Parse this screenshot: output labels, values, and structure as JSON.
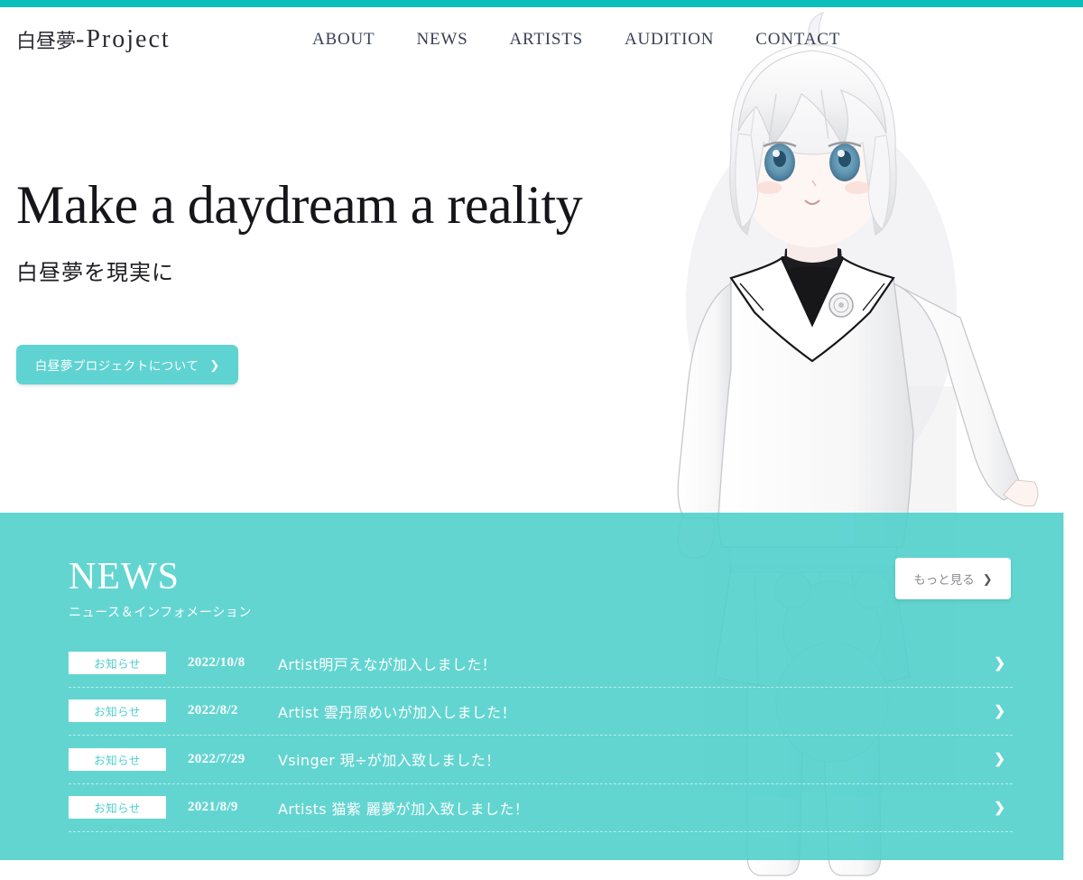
{
  "site": {
    "logo_jp": "白昼夢",
    "logo_sep": "-",
    "logo_en": "Project"
  },
  "nav": {
    "items": [
      {
        "label": "ABOUT"
      },
      {
        "label": "NEWS"
      },
      {
        "label": "ARTISTS"
      },
      {
        "label": "AUDITION"
      },
      {
        "label": "CONTACT"
      }
    ]
  },
  "hero": {
    "title": "Make a daydream a reality",
    "subtitle": "白昼夢を現実に",
    "cta_label": "白昼夢プロジェクトについて",
    "cta_arrow": "❯"
  },
  "news": {
    "title": "NEWS",
    "subtitle": "ニュース＆インフォメーション",
    "more_label": "もっと見る",
    "more_arrow": "❯",
    "row_arrow": "❯",
    "items": [
      {
        "badge": "お知らせ",
        "date": "2022/10/8",
        "text": "Artist明戸えなが加入しました！"
      },
      {
        "badge": "お知らせ",
        "date": "2022/8/2",
        "text": "Artist 雲丹原めいが加入しました！"
      },
      {
        "badge": "お知らせ",
        "date": "2022/7/29",
        "text": "Vsinger 現÷が加入致しました！"
      },
      {
        "badge": "お知らせ",
        "date": "2021/8/9",
        "text": "Artists 猫紫 麗夢が加入致しました！"
      }
    ]
  },
  "colors": {
    "accent_bar": "#0dbfbc",
    "brand_teal": "#4dcfcb",
    "cta_teal": "#5fd3d2",
    "text_dark": "#16161a",
    "nav_text": "#3a3f55"
  }
}
